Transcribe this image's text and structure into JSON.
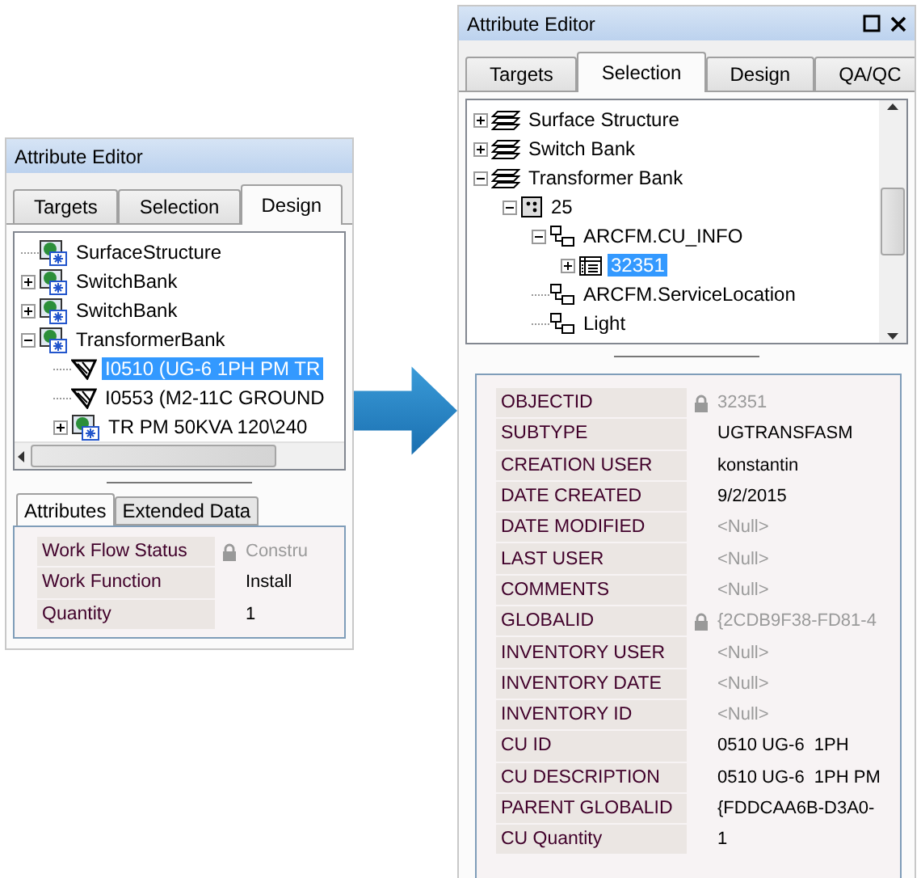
{
  "panels": [
    {
      "title": "Attribute Editor",
      "window_buttons": false,
      "tabs": [
        {
          "label": "Targets",
          "selected": false
        },
        {
          "label": "Selection",
          "selected": false
        },
        {
          "label": "Design",
          "selected": true
        }
      ],
      "tree": [
        {
          "label": "SurfaceStructure",
          "kind": "design-feature",
          "selected": false
        },
        {
          "label": "SwitchBank",
          "kind": "design-feature",
          "expanded": false,
          "selected": false
        },
        {
          "label": "SwitchBank",
          "kind": "design-feature",
          "expanded": false,
          "selected": false
        },
        {
          "label": "TransformerBank",
          "kind": "design-feature",
          "expanded": true,
          "selected": false,
          "children": [
            {
              "label": "I0510 (UG-6  1PH PM TR",
              "kind": "cu",
              "selected": true
            },
            {
              "label": "I0553 (M2-11C GROUND",
              "kind": "cu",
              "selected": false
            },
            {
              "label": "TR PM 50KVA 120\\240",
              "kind": "design-feature",
              "expanded": false,
              "selected": false
            }
          ]
        }
      ],
      "horizontal_scrollbar": true,
      "vertical_scrollbar": false,
      "detail_tabs": [
        {
          "label": "Attributes",
          "selected": true
        },
        {
          "label": "Extended Data",
          "selected": false
        }
      ],
      "attributes": [
        {
          "name": "Work Flow Status",
          "value": "Constru",
          "locked": true,
          "null": false
        },
        {
          "name": "Work Function",
          "value": "Install",
          "locked": false,
          "null": false
        },
        {
          "name": "Quantity",
          "value": "1",
          "locked": false,
          "null": false
        }
      ]
    },
    {
      "title": "Attribute Editor",
      "window_buttons": true,
      "tabs": [
        {
          "label": "Targets",
          "selected": false
        },
        {
          "label": "Selection",
          "selected": true
        },
        {
          "label": "Design",
          "selected": false
        },
        {
          "label": "QA/QC",
          "selected": false
        }
      ],
      "tree": [
        {
          "label": "Surface Structure",
          "kind": "layer",
          "expanded": false,
          "selected": false
        },
        {
          "label": "Switch Bank",
          "kind": "layer",
          "expanded": false,
          "selected": false
        },
        {
          "label": "Transformer Bank",
          "kind": "layer",
          "expanded": true,
          "selected": false,
          "children": [
            {
              "label": "25",
              "kind": "feature",
              "expanded": true,
              "selected": false,
              "children": [
                {
                  "label": "ARCFM.CU_INFO",
                  "kind": "relationship",
                  "expanded": true,
                  "selected": false,
                  "children": [
                    {
                      "label": "32351",
                      "kind": "record",
                      "expanded": false,
                      "selected": true
                    }
                  ]
                },
                {
                  "label": "ARCFM.ServiceLocation",
                  "kind": "relationship",
                  "selected": false
                },
                {
                  "label": "Light",
                  "kind": "relationship",
                  "selected": false
                }
              ]
            }
          ]
        }
      ],
      "horizontal_scrollbar": false,
      "vertical_scrollbar": true,
      "attributes": [
        {
          "name": "OBJECTID",
          "value": "32351",
          "locked": true,
          "null": false
        },
        {
          "name": "SUBTYPE",
          "value": "UGTRANSFASM",
          "locked": false,
          "null": false
        },
        {
          "name": "CREATION USER",
          "value": "konstantin",
          "locked": false,
          "null": false
        },
        {
          "name": "DATE CREATED",
          "value": "9/2/2015",
          "locked": false,
          "null": false
        },
        {
          "name": "DATE MODIFIED",
          "value": "<Null>",
          "locked": false,
          "null": true
        },
        {
          "name": "LAST USER",
          "value": "<Null>",
          "locked": false,
          "null": true
        },
        {
          "name": "COMMENTS",
          "value": "<Null>",
          "locked": false,
          "null": true
        },
        {
          "name": "GLOBALID",
          "value": "{2CDB9F38-FD81-4",
          "locked": true,
          "null": false
        },
        {
          "name": "INVENTORY USER",
          "value": "<Null>",
          "locked": false,
          "null": true
        },
        {
          "name": "INVENTORY DATE",
          "value": "<Null>",
          "locked": false,
          "null": true
        },
        {
          "name": "INVENTORY ID",
          "value": "<Null>",
          "locked": false,
          "null": true
        },
        {
          "name": "CU ID",
          "value": "0510 UG-6  1PH",
          "locked": false,
          "null": false
        },
        {
          "name": "CU DESCRIPTION",
          "value": "0510 UG-6  1PH PM",
          "locked": false,
          "null": false
        },
        {
          "name": "PARENT GLOBALID",
          "value": "{FDDCAA6B-D3A0-",
          "locked": false,
          "null": false
        },
        {
          "name": "CU Quantity",
          "value": "1",
          "locked": false,
          "null": false
        }
      ]
    }
  ]
}
